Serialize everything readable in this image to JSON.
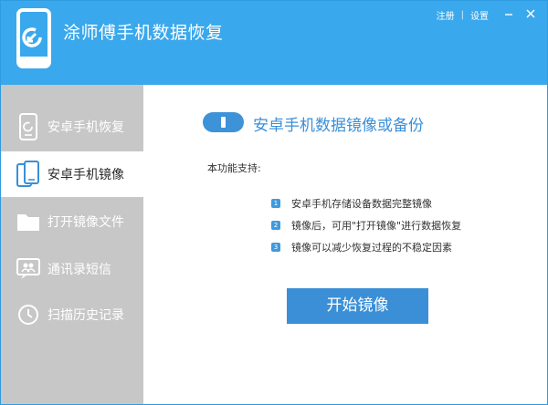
{
  "header": {
    "app_title": "涂师傅手机数据恢复",
    "register_label": "注册",
    "divider": "|",
    "settings_label": "设置",
    "minimize_icon": "minimize-icon",
    "close_icon": "close-icon"
  },
  "sidebar": {
    "items": [
      {
        "label": "安卓手机恢复",
        "icon": "android-phone-icon",
        "active": false
      },
      {
        "label": "安卓手机镜像",
        "icon": "phone-mirror-icon",
        "active": true
      },
      {
        "label": "打开镜像文件",
        "icon": "folder-icon",
        "active": false
      },
      {
        "label": "通讯录短信",
        "icon": "contacts-icon",
        "active": false
      },
      {
        "label": "扫描历史记录",
        "icon": "clock-icon",
        "active": false
      }
    ]
  },
  "main": {
    "title": "安卓手机数据镜像或备份",
    "features_label": "本功能支持:",
    "features": [
      {
        "num": "1",
        "text": "安卓手机存储设备数据完整镜像"
      },
      {
        "num": "2",
        "text": "镜像后，可用\"打开镜像\"进行数据恢复"
      },
      {
        "num": "3",
        "text": "镜像可以减少恢复过程的不稳定因素"
      }
    ],
    "start_button": "开始镜像"
  },
  "colors": {
    "header_bg": "#3aa8ec",
    "sidebar_bg": "#c7c7c7",
    "accent": "#3b8fd6"
  }
}
